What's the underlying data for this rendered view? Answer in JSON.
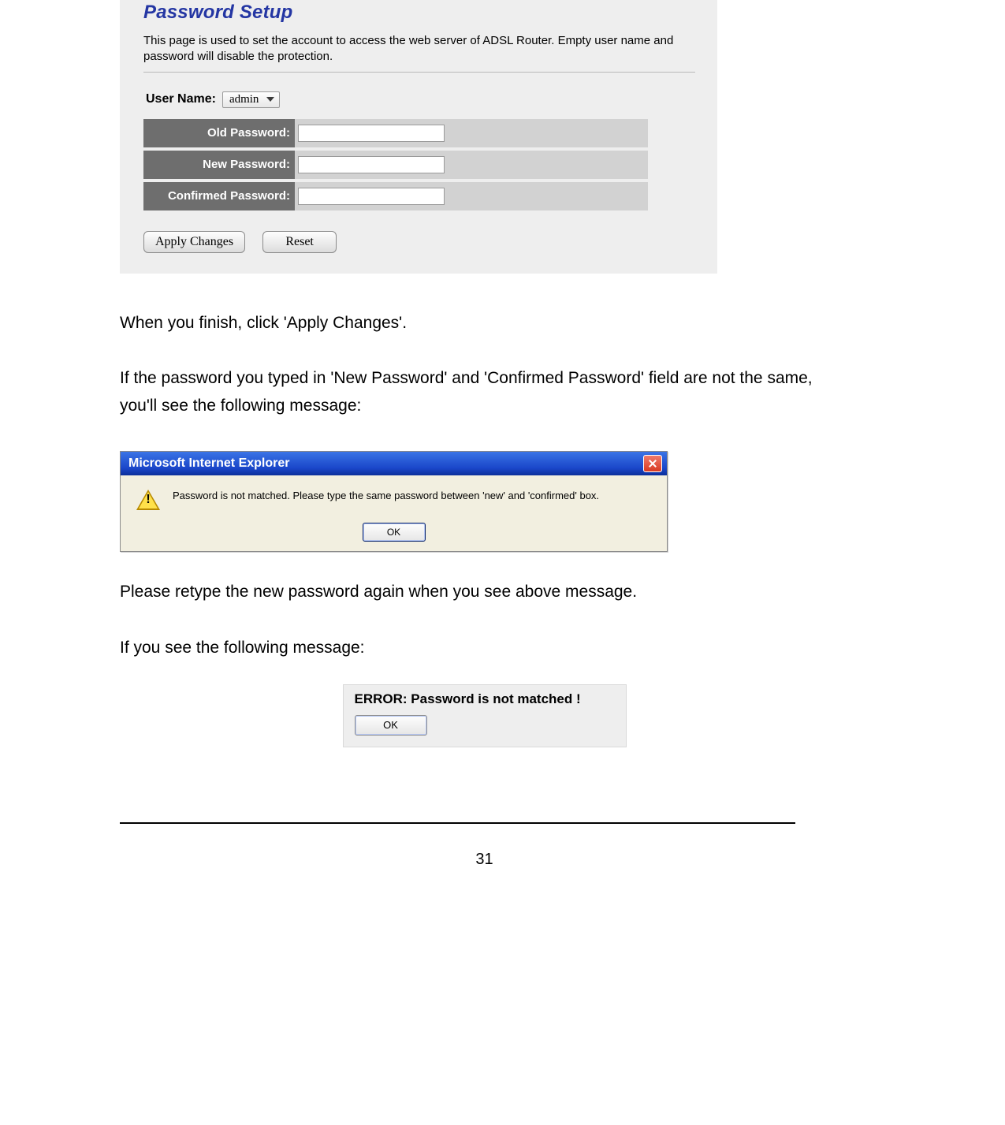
{
  "panel": {
    "title": "Password Setup",
    "desc": "This page is used to set the account to access the web server of ADSL Router. Empty user name and password will disable the protection.",
    "username_label": "User Name:",
    "username_value": "admin",
    "rows": {
      "old": "Old Password:",
      "new": "New Password:",
      "conf": "Confirmed Password:"
    },
    "apply_btn": "Apply Changes",
    "reset_btn": "Reset"
  },
  "copy": {
    "p1": "When you finish, click 'Apply Changes'.",
    "p2": "If the password you typed in 'New Password'  and 'Confirmed Password' field are not the same, you'll see the following message:",
    "p3": "Please retype the new password again when you see above message.",
    "p4": "If you see the following message:"
  },
  "dialog": {
    "title": "Microsoft Internet Explorer",
    "msg": "Password is not matched. Please type the same password between 'new' and 'confirmed' box.",
    "ok": "OK"
  },
  "error_panel": {
    "msg": "ERROR: Password is not matched !",
    "ok": "OK"
  },
  "page_number": "31"
}
